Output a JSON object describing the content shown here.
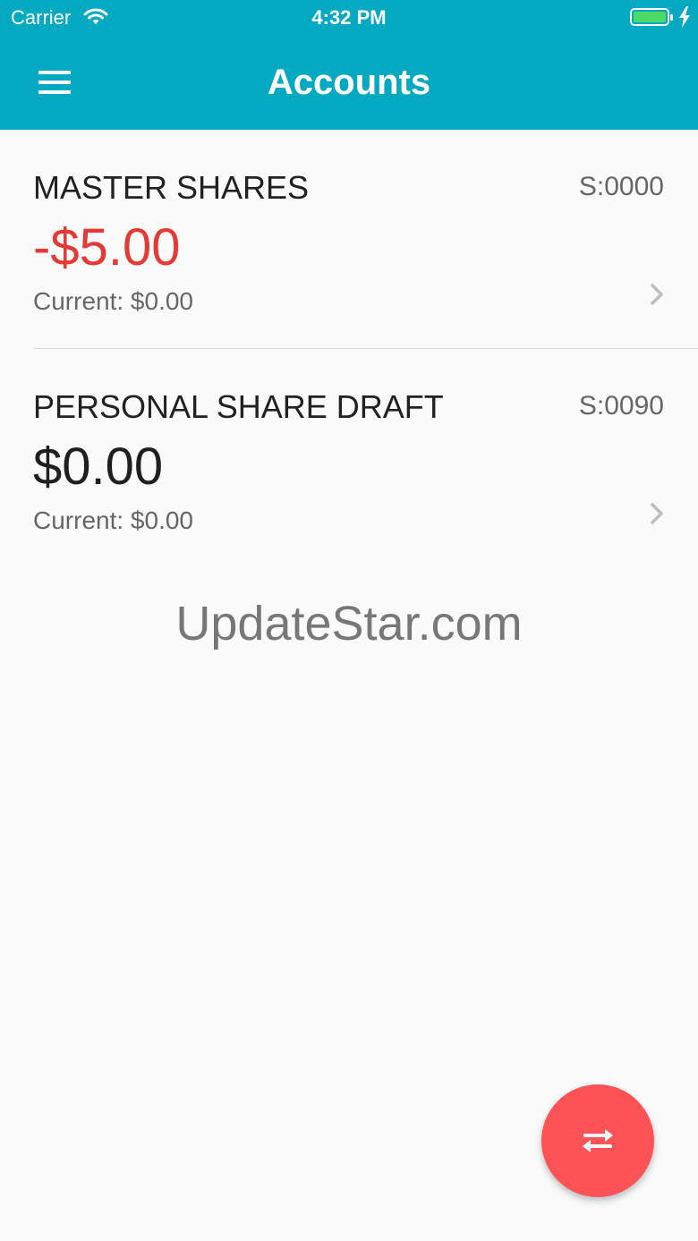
{
  "status_bar": {
    "carrier": "Carrier",
    "time": "4:32 PM"
  },
  "header": {
    "title": "Accounts"
  },
  "accounts": [
    {
      "name": "MASTER SHARES",
      "number": "S:0000",
      "balance": "-$5.00",
      "current": "Current: $0.00"
    },
    {
      "name": "PERSONAL SHARE DRAFT",
      "number": "S:0090",
      "balance": "$0.00",
      "current": "Current: $0.00"
    }
  ],
  "watermark": "UpdateStar.com",
  "icons": {
    "menu": "hamburger-menu-icon",
    "chevron": "chevron-right-icon",
    "transfer": "swap-arrows-icon"
  },
  "colors": {
    "header": "#03a9c0",
    "negative": "#e53935",
    "fab": "#fd5256",
    "battery": "#4cd964"
  }
}
